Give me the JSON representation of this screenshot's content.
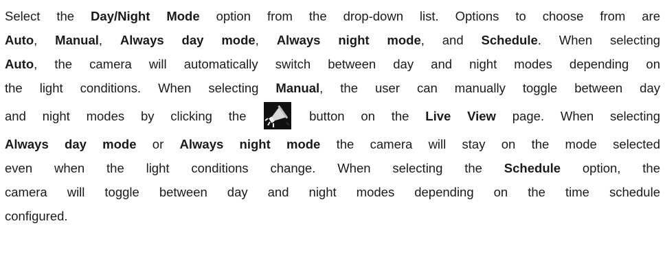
{
  "lines": [
    {
      "parts": [
        {
          "t": "Select the ",
          "b": false
        },
        {
          "t": "Day/Night Mode",
          "b": true
        },
        {
          "t": " option from the drop-down list. Options to choose from are",
          "b": false
        }
      ]
    },
    {
      "parts": [
        {
          "t": "Auto",
          "b": true
        },
        {
          "t": ", ",
          "b": false
        },
        {
          "t": "Manual",
          "b": true
        },
        {
          "t": ", ",
          "b": false
        },
        {
          "t": "Always day mode",
          "b": true
        },
        {
          "t": ", ",
          "b": false
        },
        {
          "t": "Always night mode",
          "b": true
        },
        {
          "t": ", and ",
          "b": false
        },
        {
          "t": "Schedule",
          "b": true
        },
        {
          "t": ". When selecting",
          "b": false
        }
      ]
    },
    {
      "parts": [
        {
          "t": "Auto",
          "b": true
        },
        {
          "t": ", the camera will automatically switch between day and night modes depending on",
          "b": false
        }
      ]
    },
    {
      "parts": [
        {
          "t": "the light conditions. When selecting ",
          "b": false
        },
        {
          "t": "Manual",
          "b": true
        },
        {
          "t": ", the user can manually toggle between day",
          "b": false
        }
      ]
    },
    {
      "tall": true,
      "parts": [
        {
          "t": "and night modes by clicking the ",
          "b": false
        },
        {
          "icon": "day-night-toggle-icon"
        },
        {
          "t": " button on the ",
          "b": false
        },
        {
          "t": "Live View",
          "b": true
        },
        {
          "t": " page. When selecting",
          "b": false
        }
      ]
    },
    {
      "parts": [
        {
          "t": "Always day mode",
          "b": true
        },
        {
          "t": " or ",
          "b": false
        },
        {
          "t": "Always night mode",
          "b": true
        },
        {
          "t": " the camera will stay on the mode selected",
          "b": false
        }
      ]
    },
    {
      "parts": [
        {
          "t": "even when the light conditions change. When selecting the ",
          "b": false
        },
        {
          "t": "Schedule",
          "b": true
        },
        {
          "t": " option, the",
          "b": false
        }
      ]
    },
    {
      "parts": [
        {
          "t": "camera will toggle between day and night modes depending on the time schedule",
          "b": false
        }
      ]
    },
    {
      "last": true,
      "parts": [
        {
          "t": "configured.",
          "b": false
        }
      ]
    }
  ]
}
